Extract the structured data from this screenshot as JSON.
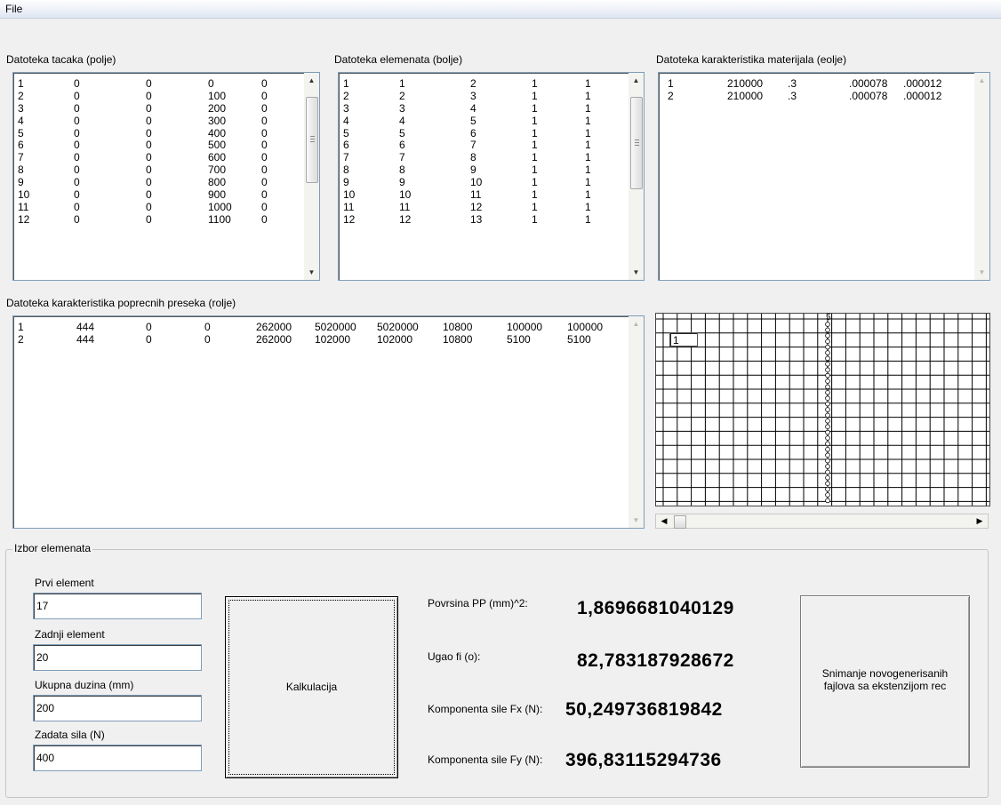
{
  "menu": {
    "file": "File"
  },
  "points": {
    "label": "Datoteka tacaka (polje)",
    "rows": [
      [
        "1",
        "0",
        "0",
        "0",
        "0"
      ],
      [
        "2",
        "0",
        "0",
        "100",
        "0"
      ],
      [
        "3",
        "0",
        "0",
        "200",
        "0"
      ],
      [
        "4",
        "0",
        "0",
        "300",
        "0"
      ],
      [
        "5",
        "0",
        "0",
        "400",
        "0"
      ],
      [
        "6",
        "0",
        "0",
        "500",
        "0"
      ],
      [
        "7",
        "0",
        "0",
        "600",
        "0"
      ],
      [
        "8",
        "0",
        "0",
        "700",
        "0"
      ],
      [
        "9",
        "0",
        "0",
        "800",
        "0"
      ],
      [
        "10",
        "0",
        "0",
        "900",
        "0"
      ],
      [
        "11",
        "0",
        "0",
        "1000",
        "0"
      ],
      [
        "12",
        "0",
        "0",
        "1100",
        "0"
      ]
    ]
  },
  "elements": {
    "label": "Datoteka elemenata (bolje)",
    "rows": [
      [
        "1",
        "1",
        "2",
        "1",
        "1"
      ],
      [
        "2",
        "2",
        "3",
        "1",
        "1"
      ],
      [
        "3",
        "3",
        "4",
        "1",
        "1"
      ],
      [
        "4",
        "4",
        "5",
        "1",
        "1"
      ],
      [
        "5",
        "5",
        "6",
        "1",
        "1"
      ],
      [
        "6",
        "6",
        "7",
        "1",
        "1"
      ],
      [
        "7",
        "7",
        "8",
        "1",
        "1"
      ],
      [
        "8",
        "8",
        "9",
        "1",
        "1"
      ],
      [
        "9",
        "9",
        "10",
        "1",
        "1"
      ],
      [
        "10",
        "10",
        "11",
        "1",
        "1"
      ],
      [
        "11",
        "11",
        "12",
        "1",
        "1"
      ],
      [
        "12",
        "12",
        "13",
        "1",
        "1"
      ]
    ]
  },
  "materials": {
    "label": "Datoteka karakteristika materijala (eolje)",
    "rows": [
      [
        "1",
        "210000",
        ".3",
        ".000078",
        ".000012"
      ],
      [
        "2",
        "210000",
        ".3",
        ".000078",
        ".000012"
      ]
    ]
  },
  "sections": {
    "label": "Datoteka karakteristika poprecnih preseka (rolje)",
    "rows": [
      [
        "1",
        "444",
        "0",
        "0",
        "262000",
        "5020000",
        "5020000",
        "10800",
        "100000",
        "100000"
      ],
      [
        "2",
        "444",
        "0",
        "0",
        "262000",
        "102000",
        "102000",
        "10800",
        "5100",
        "5100"
      ]
    ]
  },
  "canvas": {
    "node_label": "1",
    "top_label": "5"
  },
  "group": {
    "title": "Izbor elemenata",
    "first_label": "Prvi element",
    "first_value": "17",
    "last_label": "Zadnji element",
    "last_value": "20",
    "length_label": "Ukupna duzina (mm)",
    "length_value": "200",
    "force_label": "Zadata sila (N)",
    "force_value": "400",
    "calc_button": "Kalkulacija",
    "area_label": "Povrsina PP (mm)^2:",
    "area_value": "1,8696681040129",
    "angle_label": "Ugao fi (o):",
    "angle_value": "82,783187928672",
    "fx_label": "Komponenta sile Fx (N):",
    "fx_value": "50,249736819842",
    "fy_label": "Komponenta sile Fy (N):",
    "fy_value": "396,83115294736",
    "save_button_line1": "Snimanje novogenerisanih",
    "save_button_line2": "fajlova sa ekstenzijom rec"
  }
}
